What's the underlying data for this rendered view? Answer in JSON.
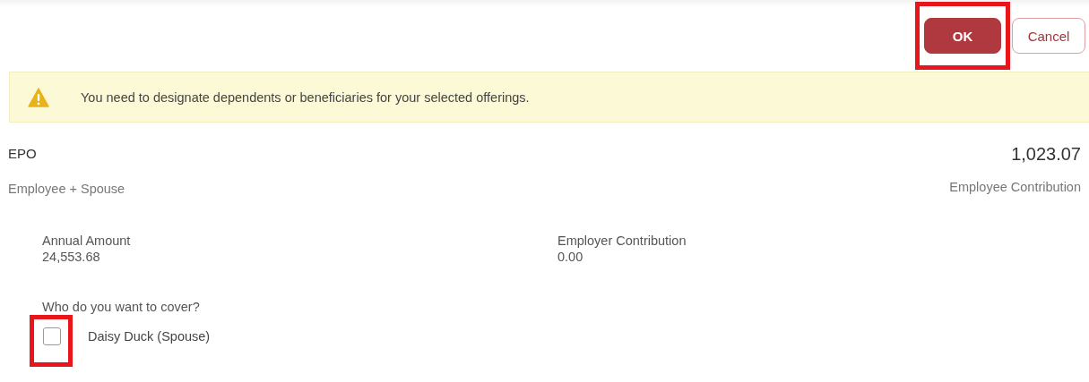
{
  "actions": [
    {
      "kind": "primary",
      "label": "OK",
      "highlighted": true
    },
    {
      "kind": "secondary",
      "label": "Cancel",
      "highlighted": false
    }
  ],
  "warning": {
    "message": "You need to designate dependents or beneficiaries for your selected offerings."
  },
  "plan": {
    "name": "EPO",
    "coverage": "Employee + Spouse",
    "amount": "1,023.07",
    "amount_label": "Employee Contribution",
    "details": [
      {
        "label": "Annual Amount",
        "value": "24,553.68"
      },
      {
        "label": "Employer Contribution",
        "value": "0.00"
      }
    ]
  },
  "coverage_question": "Who do you want to cover?",
  "dependents": [
    {
      "name": "Daisy Duck (Spouse)",
      "checked": false,
      "highlighted": true
    }
  ]
}
